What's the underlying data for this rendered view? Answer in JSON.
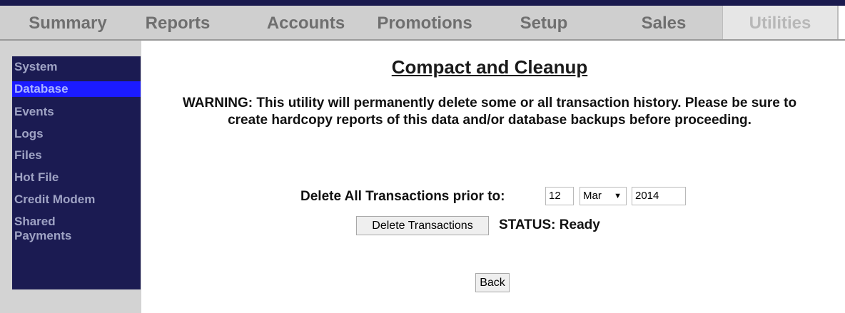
{
  "tabs": [
    {
      "label": "Summary",
      "active": false
    },
    {
      "label": "Reports",
      "active": false
    },
    {
      "label": "Accounts",
      "active": false
    },
    {
      "label": "Promotions",
      "active": false
    },
    {
      "label": "Setup",
      "active": false
    },
    {
      "label": "Sales",
      "active": false
    },
    {
      "label": "Utilities",
      "active": true
    }
  ],
  "sidebar": {
    "items": [
      {
        "label": "System"
      },
      {
        "label": "Database",
        "active": true
      },
      {
        "label": "Events"
      },
      {
        "label": "Logs"
      },
      {
        "label": "Files"
      },
      {
        "label": "Hot File"
      },
      {
        "label": "Credit Modem"
      },
      {
        "label": "Shared Payments"
      }
    ]
  },
  "main": {
    "title": "Compact and Cleanup",
    "warning": "WARNING: This utility will permanently delete some or all transaction history. Please be sure to create hardcopy reports of this data and/or database backups before proceeding.",
    "delete_label": "Delete All Transactions prior to:",
    "day_value": "12",
    "month_value": "Mar",
    "year_value": "2014",
    "delete_button": "Delete Transactions",
    "status": "STATUS: Ready",
    "back_button": "Back"
  },
  "colors": {
    "nav_bg": "#1b1b52",
    "nav_active": "#1b1bff",
    "tabbar_bg": "#cfcfcf"
  }
}
